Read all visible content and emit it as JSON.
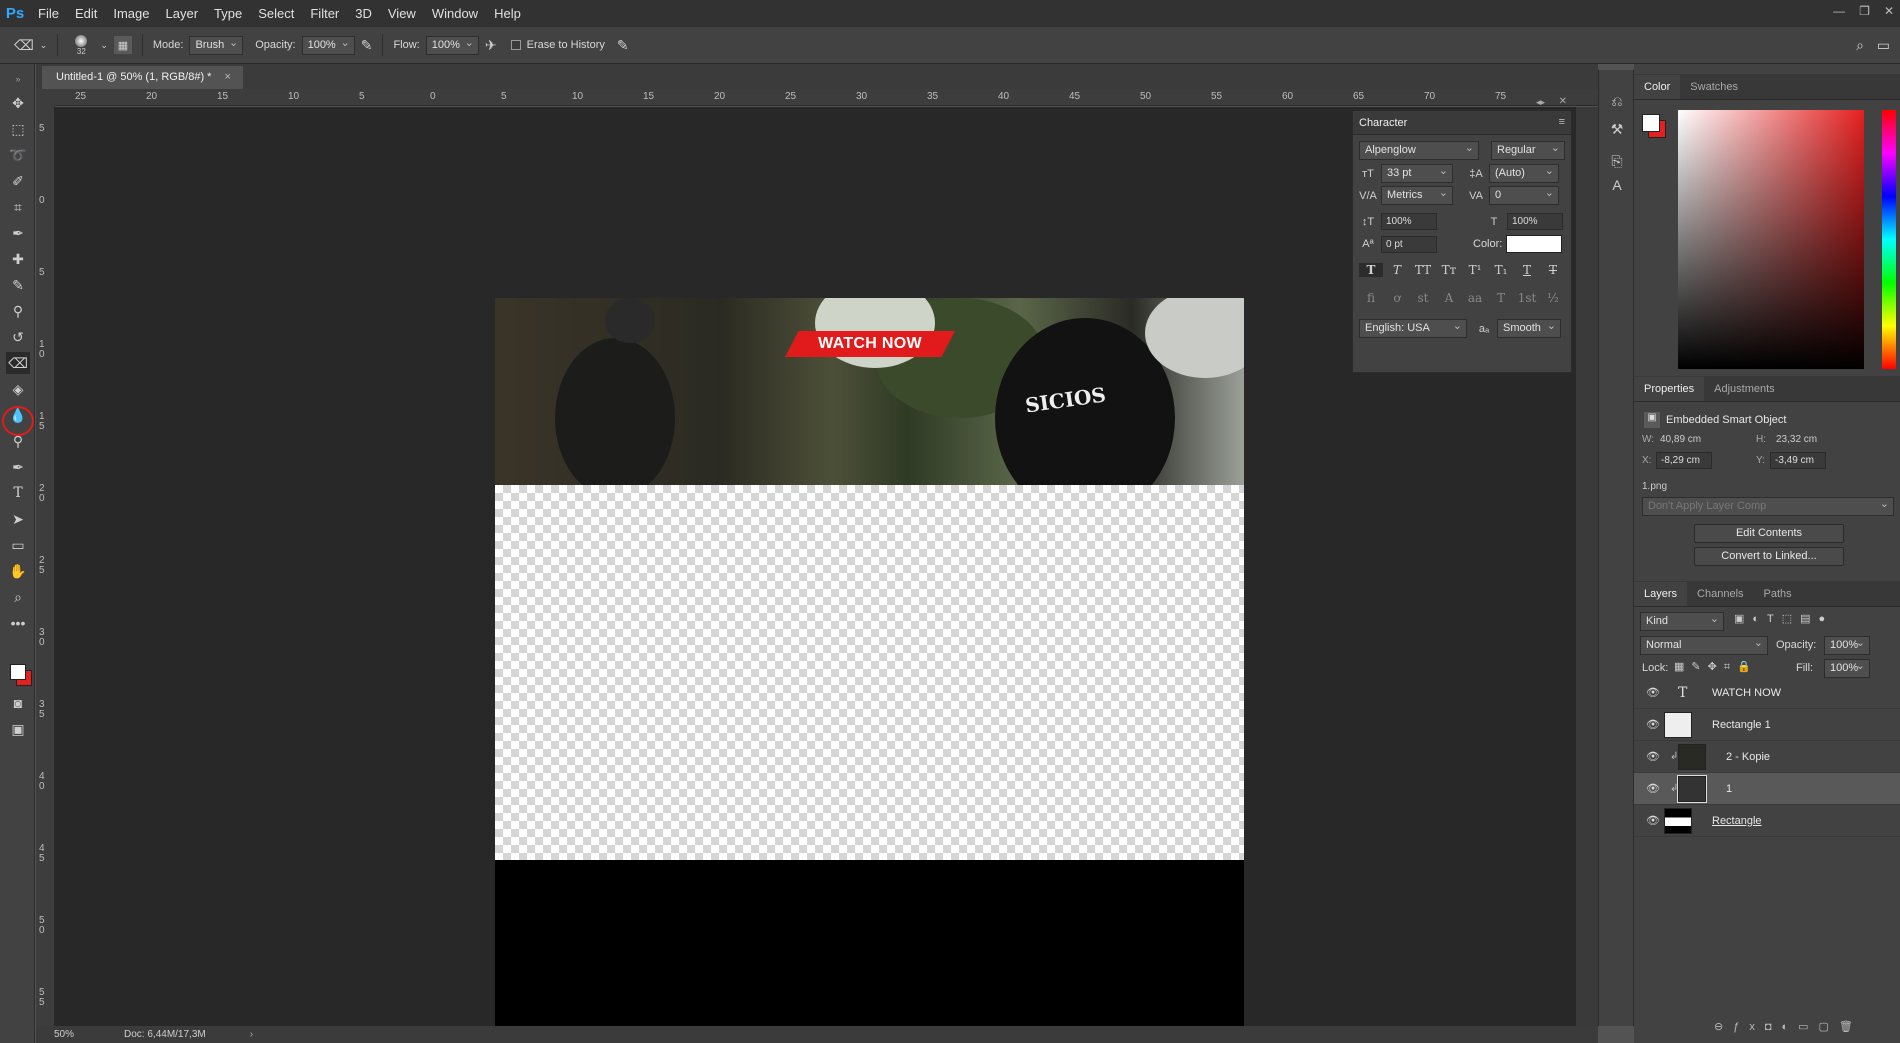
{
  "app": {
    "logo": "Ps"
  },
  "menu": [
    "File",
    "Edit",
    "Image",
    "Layer",
    "Type",
    "Select",
    "Filter",
    "3D",
    "View",
    "Window",
    "Help"
  ],
  "window_controls": [
    "—",
    "❐",
    "✕"
  ],
  "options_bar": {
    "brush_size": "32",
    "mode_label": "Mode:",
    "mode_value": "Brush",
    "opacity_label": "Opacity:",
    "opacity_value": "100%",
    "flow_label": "Flow:",
    "flow_value": "100%",
    "erase_history_label": "Erase to History"
  },
  "document": {
    "tab_title": "Untitled-1 @ 50% (1, RGB/8#) *",
    "close": "×"
  },
  "ruler_h": [
    "25",
    "20",
    "15",
    "10",
    "5",
    "0",
    "5",
    "10",
    "15",
    "20",
    "25",
    "30",
    "35",
    "40",
    "45",
    "50",
    "55",
    "60",
    "65",
    "70",
    "75"
  ],
  "ruler_v": [
    "5",
    "0",
    "5",
    "1 0",
    "1 5",
    "2 0",
    "2 5",
    "3 0",
    "3 5",
    "4 0",
    "4 5",
    "5 0",
    "5 5"
  ],
  "canvas": {
    "banner_text": "WATCH NOW",
    "shirt_text": "SICIOS"
  },
  "status": {
    "zoom": "50%",
    "doc": "Doc: 6,44M/17,3M"
  },
  "character_panel": {
    "title": "Character",
    "font_family": "Alpenglow",
    "font_style": "Regular",
    "size": "33 pt",
    "leading": "(Auto)",
    "kerning": "Metrics",
    "tracking": "0",
    "vscale": "100%",
    "hscale": "100%",
    "baseline": "0 pt",
    "color_label": "Color:",
    "type_buttons": [
      "T",
      "T",
      "TT",
      "Tт",
      "T¹",
      "T₁",
      "T",
      "T"
    ],
    "ot_buttons": [
      "fi",
      "ơ",
      "st",
      "A",
      "aa",
      "T",
      "1st",
      "½"
    ],
    "language": "English: USA",
    "aa_label": "aₐ",
    "antialias": "Smooth"
  },
  "color_panel": {
    "tabs": [
      "Color",
      "Swatches"
    ],
    "accent": "#e52020"
  },
  "properties_panel": {
    "tabs": [
      "Properties",
      "Adjustments"
    ],
    "type": "Embedded Smart Object",
    "w_label": "W:",
    "w": "40,89 cm",
    "h_label": "H:",
    "h": "23,32 cm",
    "x_label": "X:",
    "x": "-8,29 cm",
    "y_label": "Y:",
    "y": "-3,49 cm",
    "file": "1.png",
    "layer_comp": "Don't Apply Layer Comp",
    "edit_contents": "Edit Contents",
    "convert": "Convert to Linked..."
  },
  "layers_panel": {
    "tabs": [
      "Layers",
      "Channels",
      "Paths"
    ],
    "filter": "Kind",
    "blend": "Normal",
    "opacity_label": "Opacity:",
    "opacity": "100%",
    "lock_label": "Lock:",
    "fill_label": "Fill:",
    "fill": "100%",
    "layers": [
      {
        "name": "WATCH NOW",
        "kind": "text"
      },
      {
        "name": "Rectangle 1",
        "kind": "shape"
      },
      {
        "name": "2 - Kopie",
        "kind": "smart"
      },
      {
        "name": "1",
        "kind": "smart"
      },
      {
        "name": "Rectangle",
        "kind": "shape"
      }
    ]
  }
}
